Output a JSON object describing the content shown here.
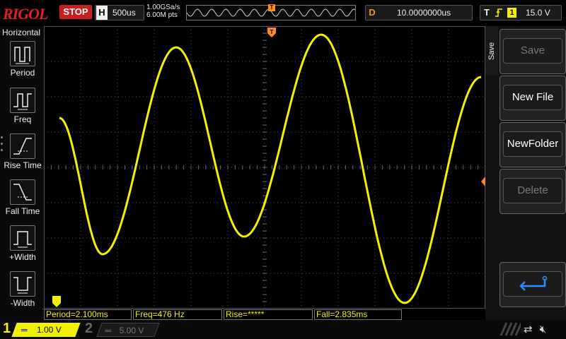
{
  "brand": "RIGOL",
  "run_state": "STOP",
  "timebase": {
    "label": "H",
    "value": "500us"
  },
  "sampling": {
    "rate": "1.00GSa/s",
    "points": "6.00M pts"
  },
  "delay": {
    "label": "D",
    "value": "10.0000000us"
  },
  "trigger": {
    "label": "T",
    "source": "1",
    "level": "15.0 V"
  },
  "trigger_marker": "T",
  "left_panel": {
    "title": "Horizontal",
    "items": [
      {
        "label": "Period",
        "icon": "period-icon"
      },
      {
        "label": "Freq",
        "icon": "freq-icon"
      },
      {
        "label": "Rise Time",
        "icon": "rise-time-icon"
      },
      {
        "label": "Fall Time",
        "icon": "fall-time-icon"
      },
      {
        "label": "+Width",
        "icon": "positive-width-icon"
      },
      {
        "label": "-Width",
        "icon": "negative-width-icon"
      }
    ]
  },
  "right_menu": {
    "tab": "Save",
    "buttons": [
      {
        "label": "Save",
        "enabled": false
      },
      {
        "label": "New File",
        "enabled": true
      },
      {
        "label": "NewFolder",
        "enabled": true
      },
      {
        "label": "Delete",
        "enabled": false
      }
    ],
    "return_icon": "return-arrow-icon"
  },
  "measurements": [
    {
      "text": "Period=2.100ms"
    },
    {
      "text": "Freq=476 Hz"
    },
    {
      "text": "Rise=*****"
    },
    {
      "text": "Fall=2.835ms"
    }
  ],
  "channels": [
    {
      "num": "1",
      "scale": "1.00 V",
      "active": true
    },
    {
      "num": "2",
      "scale": "5.00 V",
      "active": false
    }
  ],
  "status_icons": [
    "usb-icon",
    "speaker-mute-icon"
  ],
  "colors": {
    "ch1": "#f2f200",
    "accent": "#ff8c1a",
    "stop": "#c81e1e",
    "grid": "#555555"
  }
}
